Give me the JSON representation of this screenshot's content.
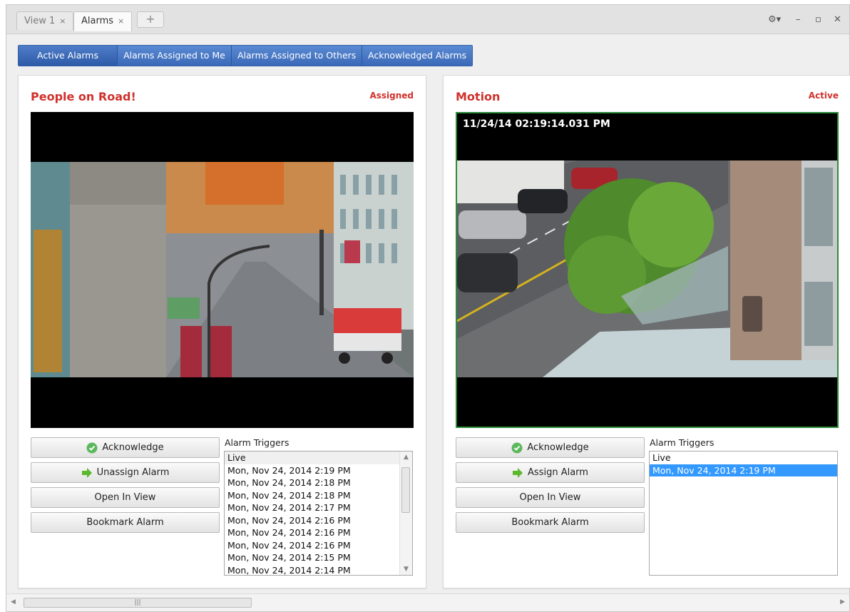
{
  "tabs": [
    {
      "label": "View 1",
      "close": "×"
    },
    {
      "label": "Alarms",
      "close": "×"
    }
  ],
  "add_tab_label": "+",
  "window_controls": {
    "settings": "⚙▾",
    "minimize": "–",
    "maximize": "▫",
    "close": "✕"
  },
  "filter_tabs": [
    "Active Alarms",
    "Alarms Assigned to Me",
    "Alarms Assigned to Others",
    "Acknowledged Alarms"
  ],
  "panels": [
    {
      "title": "People on Road!",
      "status": "Assigned",
      "timestamp": "",
      "buttons": {
        "acknowledge": "Acknowledge",
        "assign": "Unassign Alarm",
        "open": "Open In View",
        "bookmark": "Bookmark Alarm"
      },
      "triggers_label": "Alarm Triggers",
      "triggers": [
        "Live",
        "Mon, Nov 24, 2014 2:19 PM",
        "Mon, Nov 24, 2014 2:18 PM",
        "Mon, Nov 24, 2014 2:18 PM",
        "Mon, Nov 24, 2014 2:17 PM",
        "Mon, Nov 24, 2014 2:16 PM",
        "Mon, Nov 24, 2014 2:16 PM",
        "Mon, Nov 24, 2014 2:16 PM",
        "Mon, Nov 24, 2014 2:15 PM",
        "Mon, Nov 24, 2014 2:14 PM"
      ]
    },
    {
      "title": "Motion",
      "status": "Active",
      "timestamp": "11/24/14 02:19:14.031 PM",
      "buttons": {
        "acknowledge": "Acknowledge",
        "assign": "Assign Alarm",
        "open": "Open In View",
        "bookmark": "Bookmark Alarm"
      },
      "triggers_label": "Alarm Triggers",
      "triggers": [
        "Live",
        "Mon, Nov 24, 2014 2:19 PM"
      ],
      "selected_trigger": "Mon, Nov 24, 2014 2:19 PM"
    }
  ],
  "colors": {
    "alarm_red": "#d0312c",
    "tab_blue": "#3a69b8",
    "active_border": "#2e8b3a",
    "selection": "#3399ff"
  }
}
